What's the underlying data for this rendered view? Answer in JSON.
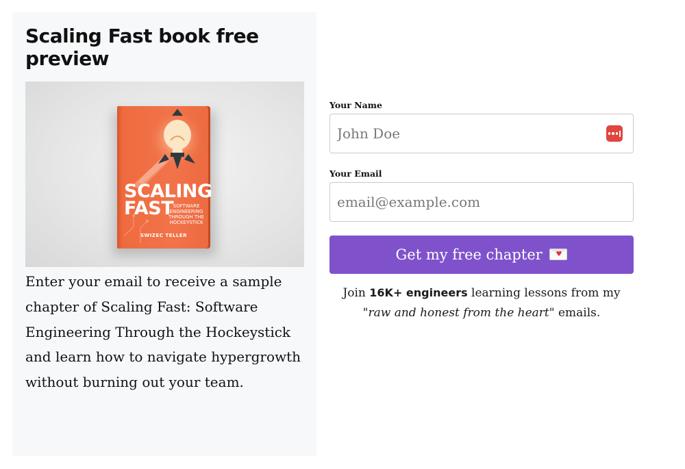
{
  "preview": {
    "title": "Scaling Fast book free preview",
    "cover_image_alt": "Scaling Fast book cover",
    "book": {
      "title_line1": "SCALING",
      "title_line2": "FAST",
      "subtitle": "SOFTWARE ENGINEERING THROUGH THE HOCKEYSTICK",
      "author": "SWIZEC TELLER"
    },
    "description": "Enter your email to receive a sample chapter of Scaling Fast: Software Engineering Through the Hockeystick and learn how to navigate hypergrowth without burning out your team."
  },
  "form": {
    "name_label": "Your Name",
    "name_placeholder": "John Doe",
    "email_label": "Your Email",
    "email_placeholder": "email@example.com",
    "submit_label": "Get my free chapter",
    "submit_icon": "love-letter-icon",
    "note": {
      "prefix": "Join ",
      "bold": "16K+ engineers",
      "middle": " learning lessons from my ",
      "italic": "\"raw and honest from the heart\"",
      "suffix": " emails."
    }
  },
  "icons": {
    "password_manager": "password-manager-icon"
  },
  "colors": {
    "button": "#7f52cc",
    "panel_bg": "#f7f8fa",
    "book": "#f2734a",
    "password_icon": "#e0463d"
  }
}
